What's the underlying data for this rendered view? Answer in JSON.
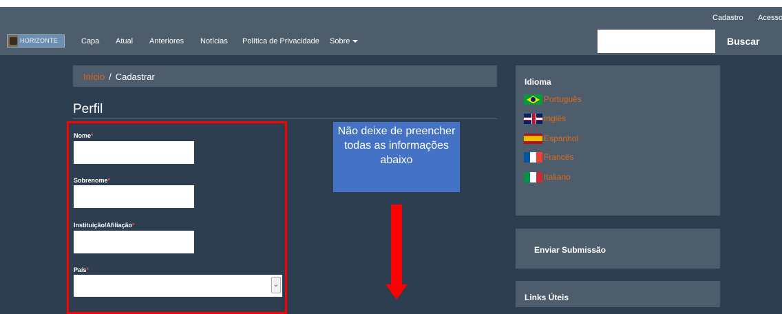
{
  "userbar": {
    "register": "Cadastro",
    "login": "Acesso"
  },
  "navbar": {
    "logo_text": "HORIZONTE",
    "items": [
      {
        "label": "Capa"
      },
      {
        "label": "Atual"
      },
      {
        "label": "Anteriores"
      },
      {
        "label": "Notícias"
      },
      {
        "label": "Política de Privacidade"
      },
      {
        "label": "Sobre"
      }
    ],
    "search": {
      "value": "",
      "button": "Buscar"
    }
  },
  "breadcrumb": {
    "home": "Início",
    "separator": "/",
    "current": "Cadastrar"
  },
  "page_title": "Perfil",
  "form": {
    "required_mark": "*",
    "fields": [
      {
        "label": "Nome",
        "value": ""
      },
      {
        "label": "Sobrenome",
        "value": ""
      },
      {
        "label": "Instituição/Afiliação",
        "value": ""
      },
      {
        "label": "País",
        "selected": ""
      }
    ]
  },
  "annotation": {
    "note": "Não deixe de preencher todas as informações abaixo",
    "color": "#4472c4",
    "highlight_color": "#ff0000"
  },
  "sidebar": {
    "language_title": "Idioma",
    "languages": [
      {
        "label": "Português",
        "flag": "brazil-flag-icon"
      },
      {
        "label": "Inglês",
        "flag": "uk-flag-icon"
      },
      {
        "label": "Espanhol",
        "flag": "spain-flag-icon"
      },
      {
        "label": "Francês",
        "flag": "france-flag-icon"
      },
      {
        "label": "Italiano",
        "flag": "italy-flag-icon"
      }
    ],
    "submit_label": "Enviar Submissão",
    "links_title": "Links Úteis"
  },
  "colors": {
    "background": "#2c3e50",
    "panel": "#4e5d6c",
    "accent": "#df691a"
  }
}
